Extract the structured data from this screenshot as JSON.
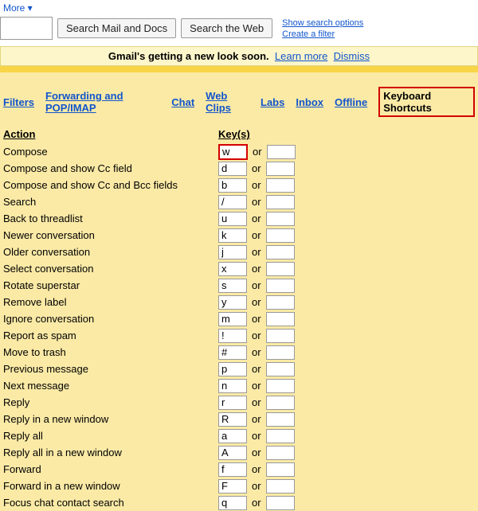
{
  "top": {
    "more_label": "More ▾",
    "search_mail_btn": "Search Mail and Docs",
    "search_web_btn": "Search the Web",
    "show_options": "Show search options",
    "create_filter": "Create a filter"
  },
  "banner": {
    "text_bold": "Gmail's getting a new look soon.",
    "learn_more": "Learn more",
    "dismiss": "Dismiss"
  },
  "tabs": {
    "filters": "Filters",
    "fwd": "Forwarding and POP/IMAP",
    "chat": "Chat",
    "webclips": "Web Clips",
    "labs": "Labs",
    "inbox": "Inbox",
    "offline": "Offline",
    "shortcuts": "Keyboard Shortcuts"
  },
  "headers": {
    "action": "Action",
    "keys": "Key(s)"
  },
  "or_label": "or",
  "shortcuts": [
    {
      "action": "Compose",
      "key": "w",
      "hl": true
    },
    {
      "action": "Compose and show Cc field",
      "key": "d"
    },
    {
      "action": "Compose and show Cc and Bcc fields",
      "key": "b"
    },
    {
      "action": "Search",
      "key": "/"
    },
    {
      "action": "Back to threadlist",
      "key": "u"
    },
    {
      "action": "Newer conversation",
      "key": "k"
    },
    {
      "action": "Older conversation",
      "key": "j"
    },
    {
      "action": "Select conversation",
      "key": "x"
    },
    {
      "action": "Rotate superstar",
      "key": "s"
    },
    {
      "action": "Remove label",
      "key": "y"
    },
    {
      "action": "Ignore conversation",
      "key": "m"
    },
    {
      "action": "Report as spam",
      "key": "!"
    },
    {
      "action": "Move to trash",
      "key": "#"
    },
    {
      "action": "Previous message",
      "key": "p"
    },
    {
      "action": "Next message",
      "key": "n"
    },
    {
      "action": "Reply",
      "key": "r"
    },
    {
      "action": "Reply in a new window",
      "key": "R"
    },
    {
      "action": "Reply all",
      "key": "a"
    },
    {
      "action": "Reply all in a new window",
      "key": "A"
    },
    {
      "action": "Forward",
      "key": "f"
    },
    {
      "action": "Forward in a new window",
      "key": "F"
    },
    {
      "action": "Focus chat contact search",
      "key": "q"
    }
  ]
}
